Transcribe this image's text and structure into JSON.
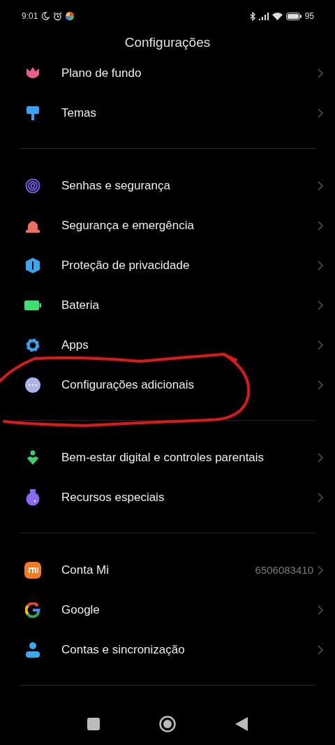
{
  "status_bar": {
    "time": "9:01",
    "battery": "95"
  },
  "title": "Configurações",
  "groups": [
    {
      "items": [
        {
          "label": "Plano de fundo"
        },
        {
          "label": "Temas"
        }
      ]
    },
    {
      "items": [
        {
          "label": "Senhas e segurança"
        },
        {
          "label": "Segurança e emergência"
        },
        {
          "label": "Proteção de privacidade"
        },
        {
          "label": "Bateria"
        },
        {
          "label": "Apps"
        },
        {
          "label": "Configurações adicionais",
          "circled": true
        }
      ]
    },
    {
      "items": [
        {
          "label": "Bem-estar digital e controles parentais"
        },
        {
          "label": "Recursos especiais"
        }
      ]
    },
    {
      "items": [
        {
          "label": "Conta Mi",
          "value": "6506083410"
        },
        {
          "label": "Google"
        },
        {
          "label": "Contas e sincronização"
        }
      ]
    }
  ]
}
